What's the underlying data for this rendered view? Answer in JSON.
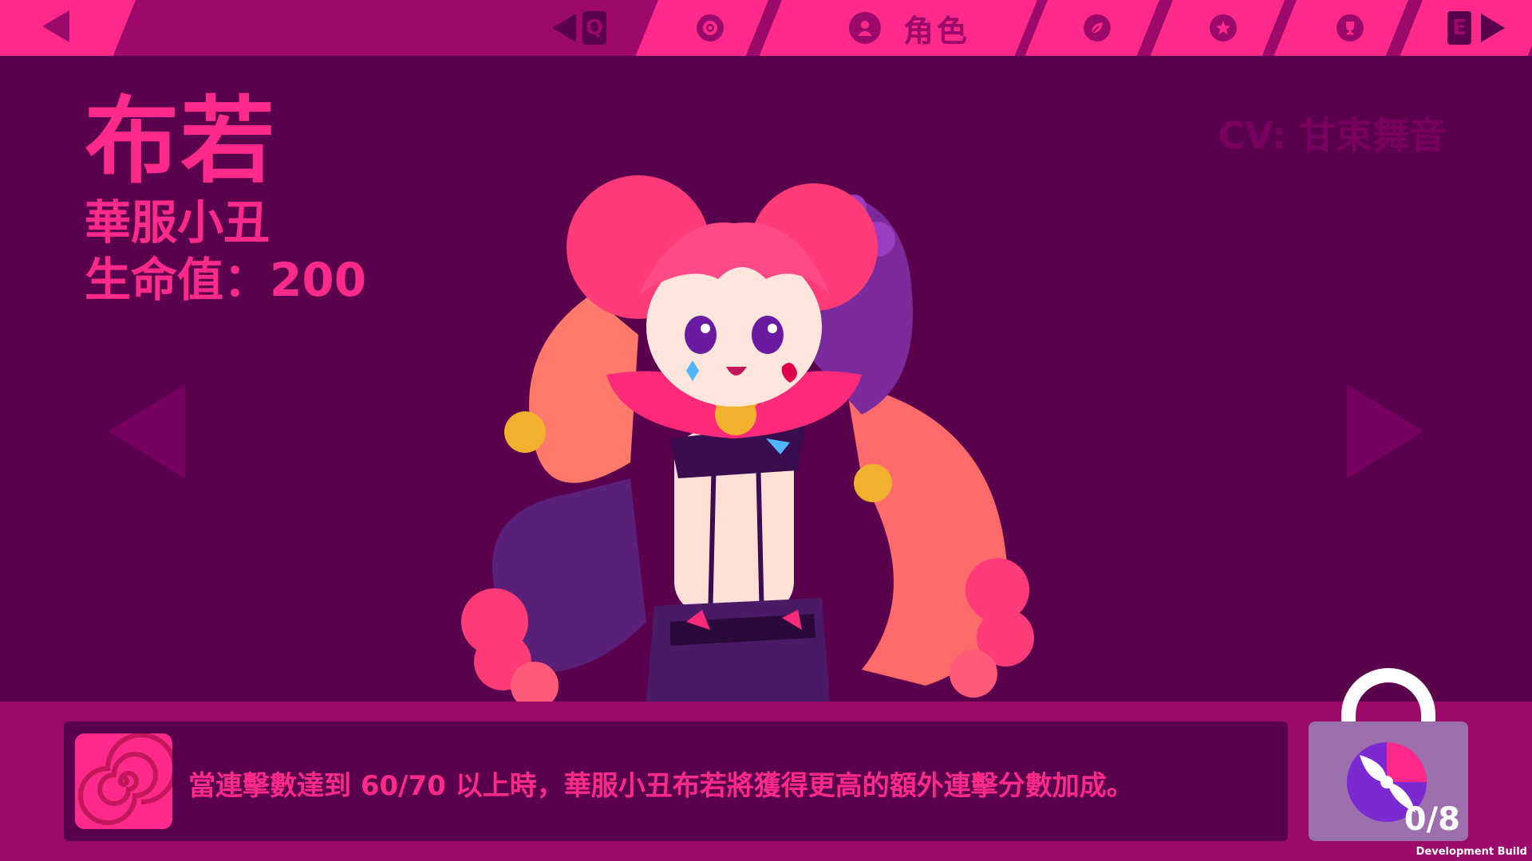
{
  "nav": {
    "back_icon": "back-arrow-icon",
    "prev_key": "Q",
    "next_key": "E",
    "tabs": [
      {
        "icon": "gear-icon",
        "label": ""
      },
      {
        "icon": "character-icon",
        "label": "角色"
      },
      {
        "icon": "leaf-icon",
        "label": ""
      },
      {
        "icon": "star-icon",
        "label": ""
      },
      {
        "icon": "trophy-icon",
        "label": ""
      }
    ],
    "active_tab": 1
  },
  "character": {
    "name": "布若",
    "title": "華服小丑",
    "hp": "生命值：200",
    "cv": "CV: 甘束舞音"
  },
  "skill": {
    "icon": "spiral-icon",
    "description": "當連擊數達到 60/70 以上時，華服小丑布若將獲得更高的額外連擊分數加成。"
  },
  "unlock": {
    "icon": "beach-ball-icon",
    "progress": "0/8",
    "current": 0,
    "total": 8
  },
  "footer": {
    "build_label": "Development Build"
  },
  "colors": {
    "accent": "#ff2a8a",
    "bar": "#9b0a6b",
    "background": "#5b004c",
    "lock": "#9e6fae"
  }
}
